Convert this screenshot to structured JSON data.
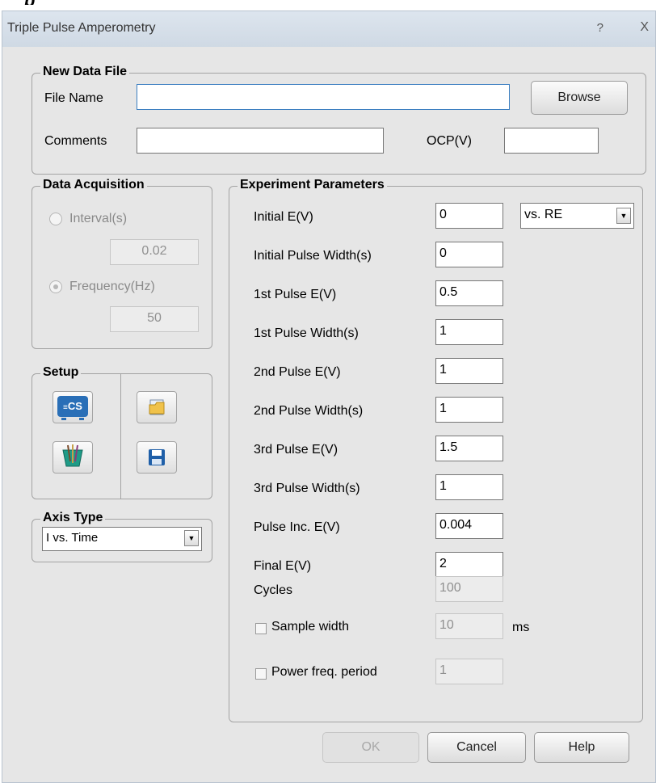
{
  "window": {
    "title": "Triple Pulse Amperometry",
    "help_glyph": "?",
    "close_glyph": "X"
  },
  "new_data_file": {
    "legend": "New Data File",
    "file_name_label": "File Name",
    "file_name_value": "",
    "browse_label": "Browse",
    "comments_label": "Comments",
    "comments_value": "",
    "ocp_label": "OCP(V)",
    "ocp_value": ""
  },
  "data_acquisition": {
    "legend": "Data Acquisition",
    "interval_label": "Interval(s)",
    "interval_value": "0.02",
    "frequency_label": "Frequency(Hz)",
    "frequency_value": "50",
    "selected": "frequency"
  },
  "setup": {
    "legend": "Setup",
    "tools": [
      {
        "icon": "cs-device-icon",
        "badge": "CS"
      },
      {
        "icon": "open-folder-icon"
      },
      {
        "icon": "electrode-icon"
      },
      {
        "icon": "save-disk-icon"
      }
    ]
  },
  "axis_type": {
    "legend": "Axis Type",
    "value": "I vs. Time"
  },
  "experiment": {
    "legend": "Experiment Parameters",
    "reference": "vs. RE",
    "params": [
      {
        "label": "Initial E(V)",
        "value": "0"
      },
      {
        "label": "Initial Pulse Width(s)",
        "value": "0"
      },
      {
        "label": "1st Pulse E(V)",
        "value": "0.5"
      },
      {
        "label": "1st Pulse Width(s)",
        "value": "1"
      },
      {
        "label": "2nd Pulse E(V)",
        "value": "1"
      },
      {
        "label": "2nd Pulse Width(s)",
        "value": "1"
      },
      {
        "label": "3rd Pulse E(V)",
        "value": "1.5"
      },
      {
        "label": "3rd Pulse Width(s)",
        "value": "1"
      },
      {
        "label": "Pulse Inc. E(V)",
        "value": "0.004"
      },
      {
        "label": "Final E(V)",
        "value": "2"
      }
    ],
    "cycles_label": "Cycles",
    "cycles_value": "100",
    "sample_width_label": "Sample width",
    "sample_width_value": "10",
    "sample_width_unit": "ms",
    "power_freq_label": "Power freq. period",
    "power_freq_value": "1"
  },
  "footer": {
    "ok": "OK",
    "cancel": "Cancel",
    "help": "Help"
  },
  "colors": {
    "title_bar": "#d5dee8",
    "panel": "#e6e6e6",
    "focus_border": "#3c7fc1",
    "cs_icon_blue": "#2a6fb7"
  }
}
